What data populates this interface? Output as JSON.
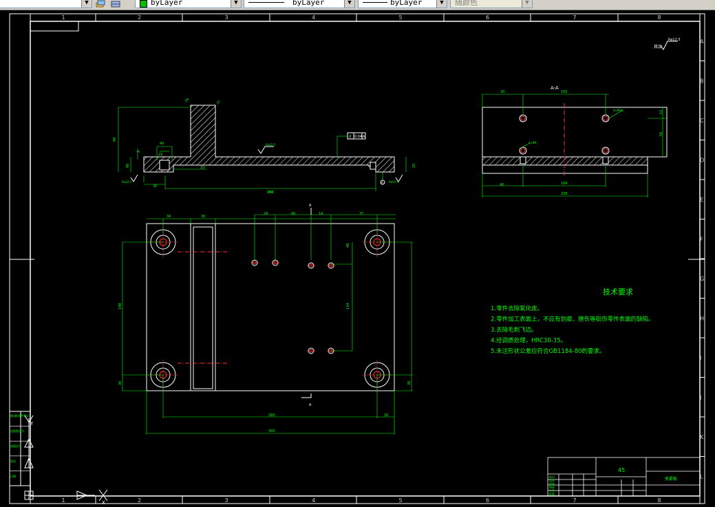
{
  "toolbar": {
    "color_control": "byLayer",
    "linetype_control": "byLayer",
    "lineweight_control": "byLayer",
    "plotstyle_control": "随颜色"
  },
  "frame": {
    "cols": [
      "1",
      "2",
      "3",
      "4",
      "5",
      "6",
      "7",
      "8"
    ],
    "rows": [
      "A",
      "B",
      "C",
      "D",
      "E",
      "F",
      "G",
      "H",
      "I",
      "J",
      "K",
      "L"
    ]
  },
  "roughness_note": "其余",
  "roughness_value": "Ra12.5",
  "front_view": {
    "dims": [
      "18",
      "27",
      "98",
      "40",
      "3",
      "90",
      "22",
      "30",
      "10",
      "20",
      "250",
      "280"
    ],
    "roughness_left": "Ra12.5",
    "roughness_right": "Ra12.5",
    "tolerance_symbol": "//",
    "tolerance_value": "0.04",
    "tolerance_datum": "A",
    "datum_label": "A"
  },
  "section_view": {
    "title": "A-A",
    "dims": [
      "30",
      "150",
      "12",
      "50",
      "40",
      "184",
      "208"
    ],
    "hole_note_top": "4×M10",
    "hole_note_bottom": "4×Φ8"
  },
  "top_view": {
    "dims": [
      "34",
      "30",
      "24",
      "40",
      "14",
      "77",
      "48",
      "198",
      "134",
      "30",
      "280",
      "20",
      "300",
      "30"
    ],
    "section_label": "A"
  },
  "tech_requirements": {
    "title": "技术要求",
    "items": [
      "1.零件去除氧化皮。",
      "2.零件加工表面上，不应有划痕、擦伤等损伤零件表面的缺陷。",
      "3.去除毛刺飞边。",
      "4.经调质处理，HRC30-35。",
      "5.未注形状公差应符合GB1184-80的要求。"
    ]
  },
  "title_block": {
    "material": "45",
    "part_name": "夹紧板",
    "rows": [
      "标记",
      "设计",
      "校核",
      "审核",
      "工艺",
      "批准"
    ]
  },
  "sidebar_stamps": [
    "借(通)用件登记",
    "旧底图总号",
    "底图总号",
    "签名",
    "日期"
  ],
  "ucs_labels": {
    "y": "Y",
    "x": "X"
  }
}
